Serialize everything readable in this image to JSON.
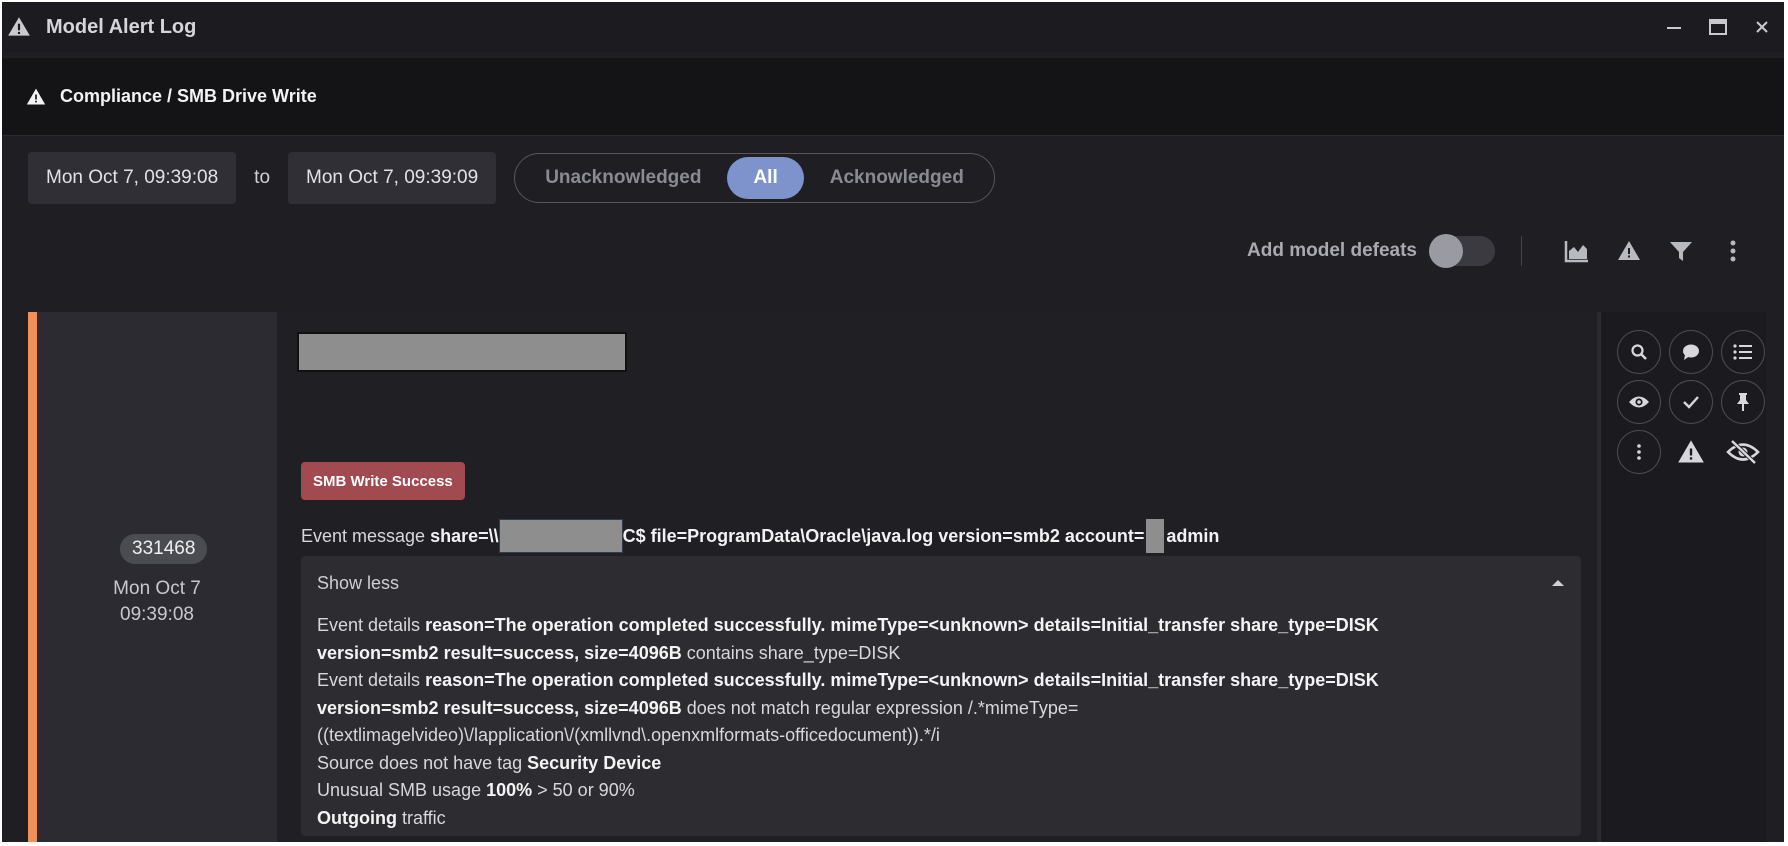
{
  "window": {
    "title": "Model Alert Log",
    "icons": [
      "warning-icon",
      "minimize-icon",
      "maximize-icon",
      "close-icon"
    ]
  },
  "model": {
    "title": "Compliance / SMB Drive Write"
  },
  "filters": {
    "from": "Mon Oct 7, 09:39:08",
    "to_label": "to",
    "to": "Mon Oct 7, 09:39:09",
    "tabs": [
      "Unacknowledged",
      "All",
      "Acknowledged"
    ],
    "active_tab": "All"
  },
  "toolbar": {
    "defeats_label": "Add model defeats",
    "defeats_enabled": false,
    "icons": [
      "chart-icon",
      "warning-icon",
      "filter-icon",
      "more-vertical-icon"
    ]
  },
  "alert": {
    "id": "331468",
    "date": "Mon Oct 7",
    "time": "09:39:08",
    "accent_color": "#f0905a",
    "badge": "SMB Write Success",
    "badge_color": "#a14b50",
    "message_label": "Event message",
    "message_share": "share=\\\\",
    "message_rest": "C$ file=ProgramData\\Oracle\\java.log version=smb2 account=",
    "message_account": "admin",
    "details_toggle": "Show less",
    "details": [
      {
        "prefix": "Event details ",
        "bold": "reason=The operation completed successfully. mimeType=<unknown> details=Initial_transfer share_type=DISK",
        "bold2": "version=smb2 result=success, size=4096B",
        "suffix": " contains share_type=DISK"
      },
      {
        "prefix": "Event details ",
        "bold": "reason=The operation completed successfully. mimeType=<unknown> details=Initial_transfer share_type=DISK",
        "bold2": "version=smb2 result=success, size=4096B",
        "suffix": " does not match regular expression /.*mimeType=",
        "suffix2": "((textlimagelvideo)\\/lapplication\\/(xmllvnd\\.openxmlformats-officedocument)).*/i"
      }
    ],
    "source_prefix": "Source does not have tag ",
    "source_tag": "Security Device",
    "usage_prefix": "Unusual SMB usage ",
    "usage_value": "100%",
    "usage_suffix": " > 50 or 90%",
    "traffic_bold": "Outgoing",
    "traffic_suffix": " traffic",
    "action_icons": [
      "search-icon",
      "comment-icon",
      "list-icon",
      "eye-icon",
      "check-icon",
      "pin-icon",
      "more-vertical-icon",
      "warning-icon",
      "eye-off-icon"
    ]
  }
}
